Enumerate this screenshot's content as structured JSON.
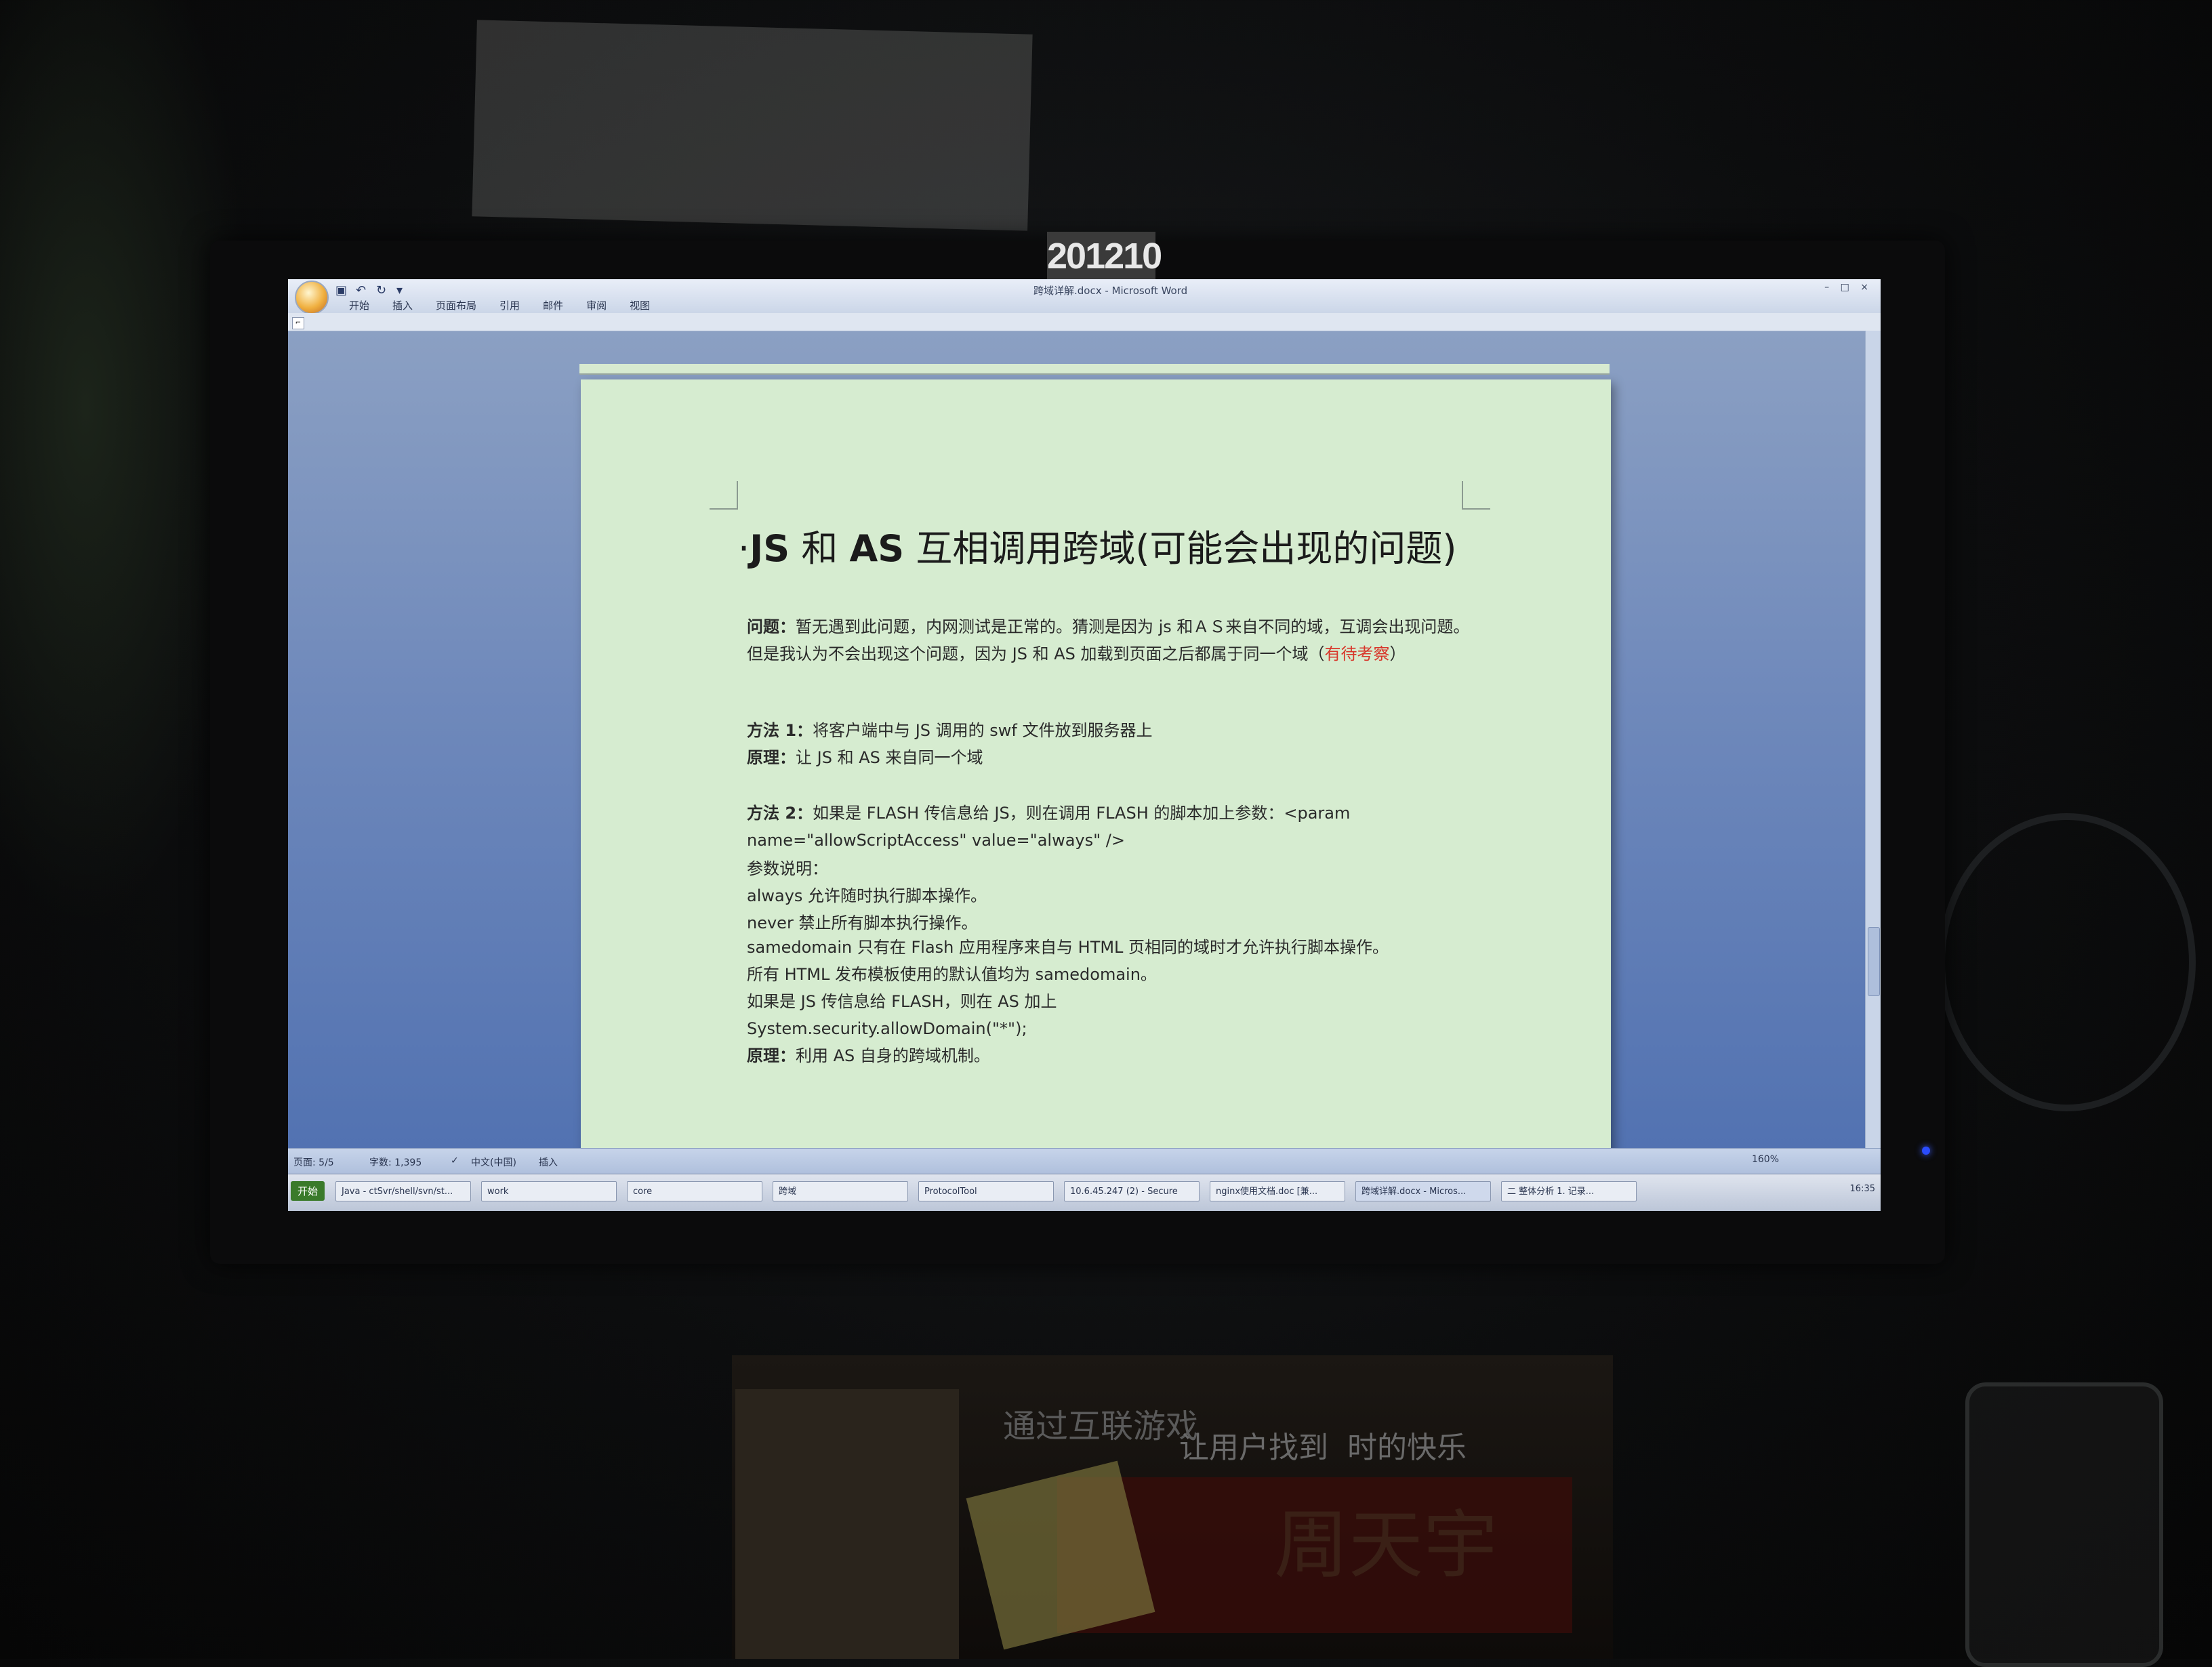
{
  "environment": {
    "sticker_text": "201210",
    "book": {
      "line1": "通过互联游戏",
      "line2": "让用户找到",
      "line2_tail": "时的快乐",
      "author": "周天宇"
    }
  },
  "window": {
    "title": "跨域详解.docx - Microsoft Word",
    "controls": "– □ ×"
  },
  "ribbon": {
    "tabs": [
      "开始",
      "插入",
      "页面布局",
      "引用",
      "邮件",
      "审阅",
      "视图"
    ]
  },
  "document": {
    "title_prefix": "·",
    "title_js": "JS",
    "title_and": " 和 ",
    "title_as": "AS",
    "title_rest": " 互相调用跨域(可能会出现的问题)",
    "p1_label": "问题：",
    "p1_text": "暂无遇到此问题，内网测试是正常的。猜测是因为 js 和ＡＳ来自不同的域，互调会出现问题。但是我认为不会出现这个问题，因为 JS 和 AS 加载到页面之后都属于同一个域（",
    "p1_red": "有待考察",
    "p1_end": "）",
    "m1_label": "方法 1：",
    "m1_text": "将客户端中与 JS 调用的 swf 文件放到服务器上",
    "r1_label": "原理：",
    "r1_text": "让 JS 和 AS 来自同一个域",
    "m2_label": "方法  2：",
    "m2_text": "如果是  FLASH  传信息给  JS，则在调用  FLASH  的脚本加上参数：<param name=\"allowScriptAccess\" value=\"always\" />",
    "params_label": "参数说明：",
    "p_always": "always  允许随时执行脚本操作。",
    "p_never": "never  禁止所有脚本执行操作。",
    "p_same": "samedomain  只有在  Flash  应用程序来自与  HTML  页相同的域时才允许执行脚本操作。",
    "p_default": "所有  HTML  发布模板使用的默认值均为   samedomain。",
    "p_js": "如果是 JS 传信息给 FLASH，则在 AS 加上",
    "p_code": "System.security.allowDomain(\"*\");",
    "r2_label": "原理：",
    "r2_text": "利用 AS 自身的跨域机制。"
  },
  "status": {
    "page": "页面: 5/5",
    "words": "字数: 1,395",
    "lang": "中文(中国)",
    "mode": "插入",
    "zoom": "160%"
  },
  "taskbar": {
    "start": "开始",
    "buttons": [
      "Java - ctSvr/shell/svn/st...",
      "work",
      "core",
      "跨域",
      "ProtocolTool",
      "10.6.45.247 (2) - Secure",
      "nginx使用文档.doc [兼...",
      "跨域详解.docx - Micros...",
      "二 整体分析 1. 记录..."
    ],
    "clock": "16:35"
  }
}
